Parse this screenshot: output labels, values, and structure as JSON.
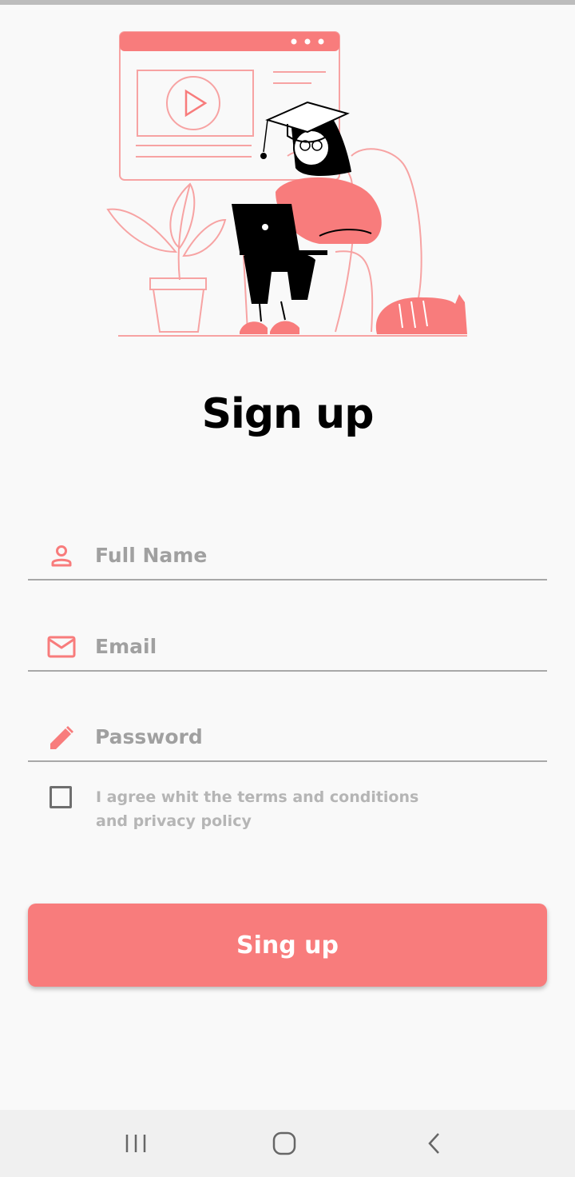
{
  "title": "Sign up",
  "form": {
    "full_name": {
      "placeholder": "Full Name",
      "value": "",
      "icon": "person-icon"
    },
    "email": {
      "placeholder": "Email",
      "value": "",
      "icon": "mail-icon"
    },
    "password": {
      "placeholder": "Password",
      "value": "",
      "icon": "pencil-icon"
    }
  },
  "agreement": {
    "line1": "I agree whit the terms and conditions",
    "line2": "and privacy policy",
    "checked": false
  },
  "submit_label": "Sing up",
  "colors": {
    "accent": "#f87c7c",
    "background": "#f9f9f9",
    "placeholder": "#a0a0a0"
  },
  "navbar": {
    "icons": [
      "recent-apps-icon",
      "home-icon",
      "back-icon"
    ]
  }
}
